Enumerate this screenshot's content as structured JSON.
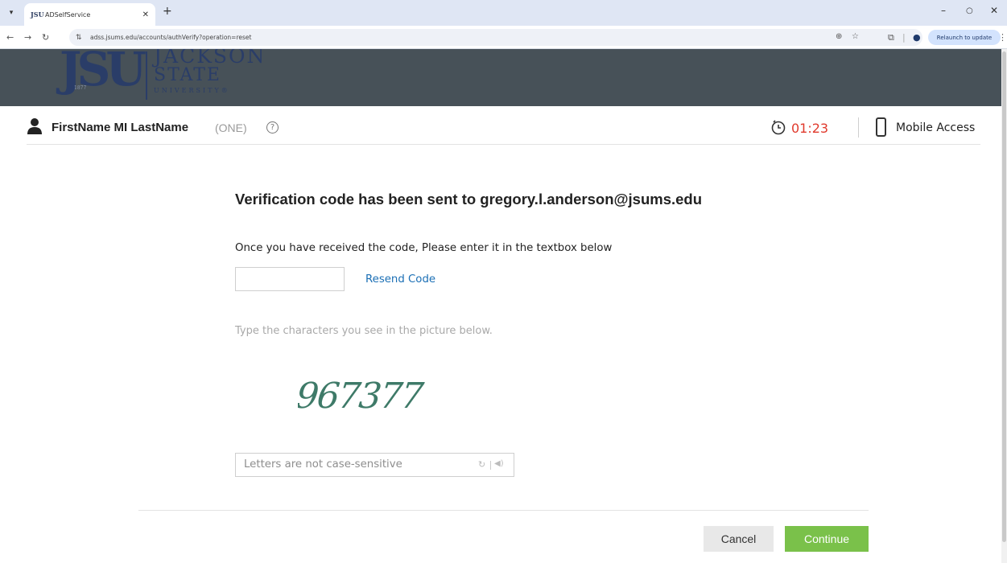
{
  "browser": {
    "tab_title": "ADSelfService",
    "tab_favicon": "JSU",
    "url": "adss.jsums.edu/accounts/authVerify?operation=reset",
    "relaunch_label": "Relaunch to update",
    "icons": [
      "tab-dropdown-icon",
      "close-icon",
      "new-tab-icon",
      "minimize-icon",
      "maximize-icon",
      "window-close-icon",
      "back-icon",
      "forward-icon",
      "reload-icon",
      "site-info-icon",
      "zoom-icon",
      "star-icon",
      "extensions-icon",
      "profile-icon",
      "menu-icon"
    ]
  },
  "header": {
    "logo_letters": "JSU",
    "logo_year": "1877",
    "logo_line1": "JACKSON",
    "logo_line2": "STATE",
    "logo_line3": "UNIVERSITY®",
    "bg_color": "#475158"
  },
  "userbar": {
    "name": "FirstName MI LastName",
    "domain": "(ONE)",
    "help": "?",
    "timer": "01:23",
    "timer_color": "#e0392c",
    "mobile_access": "Mobile Access"
  },
  "form": {
    "heading": "Verification code has been sent to gregory.l.anderson@jsums.edu",
    "instruction": "Once you have received the code, Please enter it in the textbox below",
    "code_value": "",
    "resend": "Resend Code",
    "captcha_hint": "Type the characters you see in the picture below.",
    "captcha_text": "967377",
    "captcha_placeholder": "Letters are not case-sensitive",
    "cancel": "Cancel",
    "continue": "Continue",
    "accent": "#7ac14a",
    "link_color": "#1b6fb5"
  }
}
